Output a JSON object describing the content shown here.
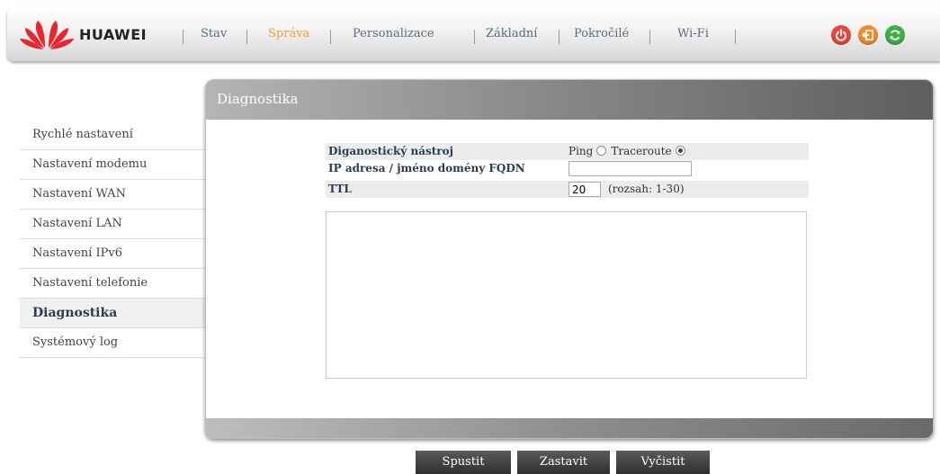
{
  "header": {
    "brand": "HUAWEI",
    "nav": [
      {
        "label": "Stav",
        "active": false
      },
      {
        "label": "Správa",
        "active": true
      },
      {
        "label": "Personalizace",
        "active": false
      },
      {
        "label": "Základní",
        "active": false
      },
      {
        "label": "Pokročilé",
        "active": false
      },
      {
        "label": "Wi-Fi",
        "active": false
      }
    ],
    "icons": [
      {
        "name": "power-icon",
        "color": "#e8463a"
      },
      {
        "name": "logout-icon",
        "color": "#f08a2c"
      },
      {
        "name": "refresh-icon",
        "color": "#3fae49"
      }
    ]
  },
  "sidebar": {
    "items": [
      {
        "label": "Rychlé nastavení",
        "active": false
      },
      {
        "label": "Nastavení modemu",
        "active": false
      },
      {
        "label": "Nastavení WAN",
        "active": false
      },
      {
        "label": "Nastavení LAN",
        "active": false
      },
      {
        "label": "Nastavení IPv6",
        "active": false
      },
      {
        "label": "Nastavení telefonie",
        "active": false
      },
      {
        "label": "Diagnostika",
        "active": true
      },
      {
        "label": "Systémový log",
        "active": false
      }
    ]
  },
  "panel": {
    "title": "Diagnostika",
    "tool": {
      "label": "Diganostický nástroj",
      "options": [
        "Ping",
        "Traceroute"
      ],
      "selected": "Traceroute"
    },
    "address": {
      "label": "IP adresa / jméno domény FQDN",
      "value": ""
    },
    "ttl": {
      "label": "TTL",
      "value": "20",
      "range": "(rozsah: 1-30)"
    },
    "output": ""
  },
  "buttons": {
    "start": "Spustit",
    "stop": "Zastavit",
    "clear": "Vyčistit"
  },
  "colors": {
    "nav_active": "#f0a328",
    "nav_text": "#5a6c7d",
    "label_text": "#2b3d4f"
  }
}
